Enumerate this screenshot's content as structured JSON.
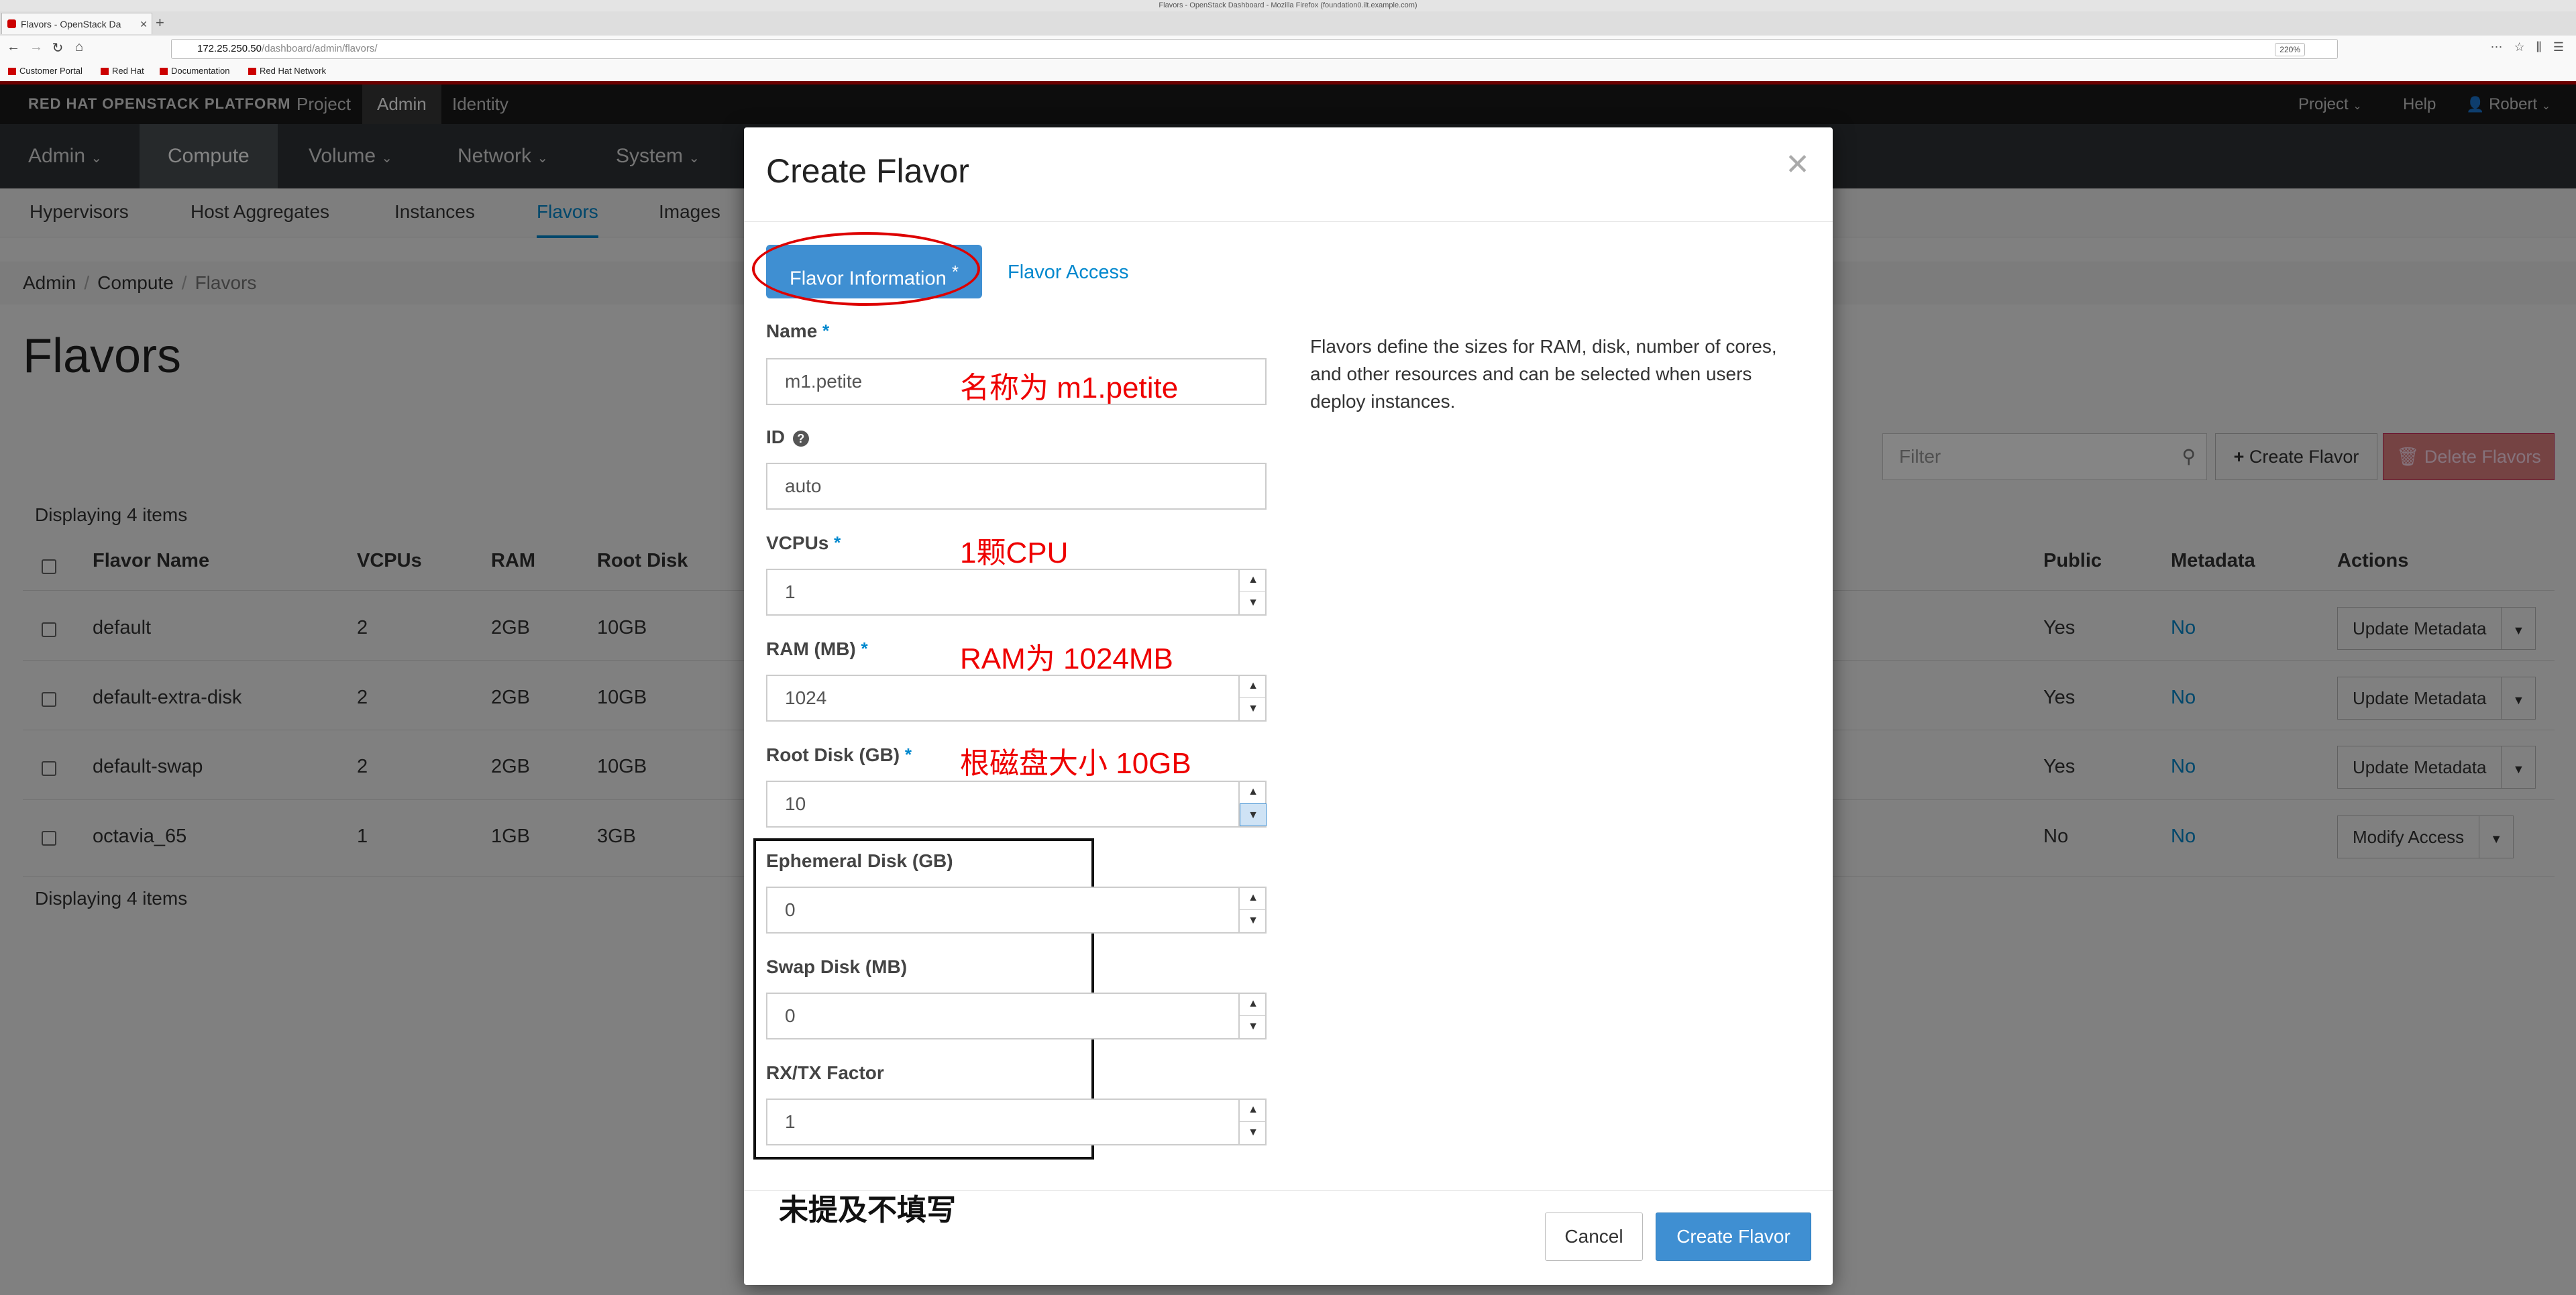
{
  "browser": {
    "window_title": "Flavors - OpenStack Dashboard - Mozilla Firefox (foundation0.ilt.example.com)",
    "tab_title": "Flavors - OpenStack Da",
    "url_host": "172.25.250.50",
    "url_path": "/dashboard/admin/flavors/",
    "zoom": "220%",
    "bookmarks": [
      "Customer Portal",
      "Red Hat",
      "Documentation",
      "Red Hat Network"
    ]
  },
  "header": {
    "brand": "RED HAT OPENSTACK PLATFORM",
    "top_tabs": [
      "Project",
      "Admin",
      "Identity"
    ],
    "right": {
      "project": "Project",
      "help": "Help",
      "user": "Robert"
    }
  },
  "nav": {
    "items": [
      "Admin",
      "Compute",
      "Volume",
      "Network",
      "System"
    ]
  },
  "subnav": {
    "items": [
      "Hypervisors",
      "Host Aggregates",
      "Instances",
      "Flavors",
      "Images"
    ]
  },
  "breadcrumb": [
    "Admin",
    "Compute",
    "Flavors"
  ],
  "page": {
    "title": "Flavors",
    "filter_placeholder": "Filter",
    "create_button": "Create Flavor",
    "delete_button": "Delete Flavors",
    "count_text": "Displaying 4 items",
    "columns": {
      "name": "Flavor Name",
      "vcpus": "VCPUs",
      "ram": "RAM",
      "disk": "Root Disk",
      "public": "Public",
      "metadata": "Metadata",
      "actions": "Actions"
    },
    "rows": [
      {
        "name": "default",
        "vcpus": "2",
        "ram": "2GB",
        "disk": "10GB",
        "public": "Yes",
        "metadata": "No",
        "action": "Update Metadata"
      },
      {
        "name": "default-extra-disk",
        "vcpus": "2",
        "ram": "2GB",
        "disk": "10GB",
        "public": "Yes",
        "metadata": "No",
        "action": "Update Metadata"
      },
      {
        "name": "default-swap",
        "vcpus": "2",
        "ram": "2GB",
        "disk": "10GB",
        "public": "Yes",
        "metadata": "No",
        "action": "Update Metadata"
      },
      {
        "name": "octavia_65",
        "vcpus": "1",
        "ram": "1GB",
        "disk": "3GB",
        "public": "No",
        "metadata": "No",
        "action": "Modify Access"
      }
    ]
  },
  "modal": {
    "title": "Create Flavor",
    "tabs": {
      "info": "Flavor Information",
      "access": "Flavor Access"
    },
    "fields": {
      "name": {
        "label": "Name",
        "value": "m1.petite"
      },
      "id": {
        "label": "ID",
        "value": "auto"
      },
      "vcpus": {
        "label": "VCPUs",
        "value": "1"
      },
      "ram": {
        "label": "RAM (MB)",
        "value": "1024"
      },
      "root_disk": {
        "label": "Root Disk (GB)",
        "value": "10"
      },
      "ephemeral": {
        "label": "Ephemeral Disk (GB)",
        "value": "0"
      },
      "swap": {
        "label": "Swap Disk (MB)",
        "value": "0"
      },
      "rxtx": {
        "label": "RX/TX Factor",
        "value": "1"
      }
    },
    "description": "Flavors define the sizes for RAM, disk, number of cores, and other resources and can be selected when users deploy instances.",
    "cancel": "Cancel",
    "submit": "Create Flavor"
  },
  "annotations": {
    "name": "名称为 m1.petite",
    "vcpus": "1颗CPU",
    "ram": "RAM为 1024MB",
    "disk": "根磁盘大小 10GB",
    "unmentioned": "未提及不填写"
  },
  "colors": {
    "accent": "#0088ce",
    "primary_button": "#3f8fd2",
    "brand_red": "#cc0000",
    "annotation_red": "#ee0000"
  }
}
